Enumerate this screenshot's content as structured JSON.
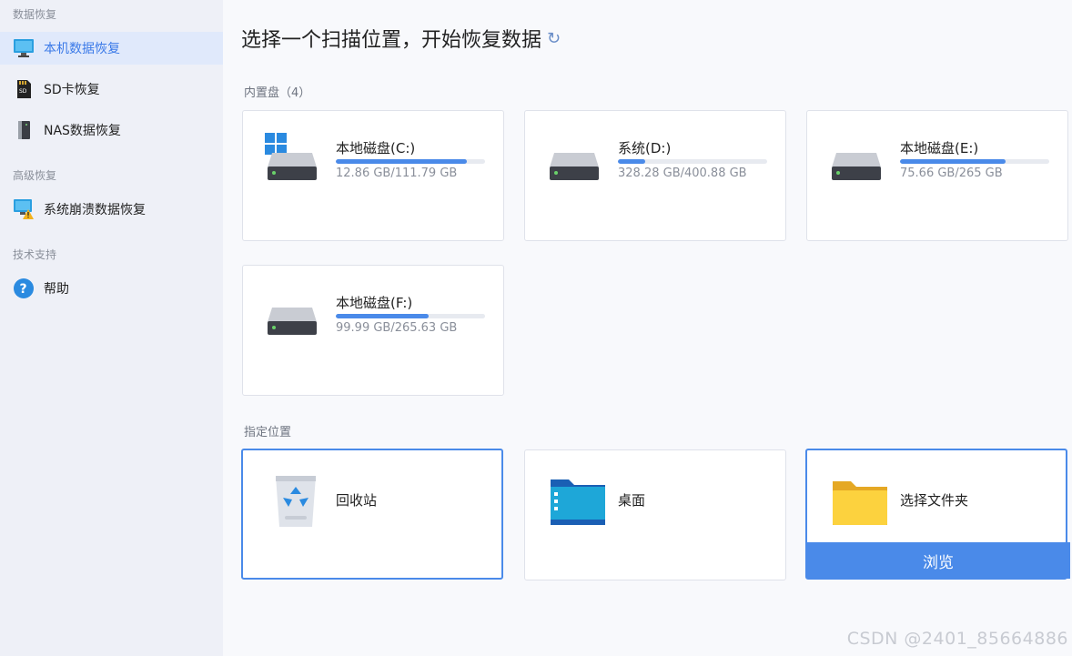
{
  "sidebar": {
    "sections": [
      {
        "title": "数据恢复"
      },
      {
        "title": "高级恢复"
      },
      {
        "title": "技术支持"
      }
    ],
    "items": [
      {
        "label": "本机数据恢复",
        "icon": "monitor-icon",
        "active": true
      },
      {
        "label": "SD卡恢复",
        "icon": "sd-card-icon"
      },
      {
        "label": "NAS数据恢复",
        "icon": "nas-icon"
      },
      {
        "label": "系统崩溃数据恢复",
        "icon": "crash-monitor-warning-icon"
      },
      {
        "label": "帮助",
        "icon": "help-question-icon"
      }
    ]
  },
  "main": {
    "title": "选择一个扫描位置，开始恢复数据",
    "refresh_icon": "↻",
    "drives_label": "内置盘（4）",
    "drives": [
      {
        "name": "本地磁盘(C:)",
        "usage": "12.86 GB/111.79 GB",
        "fill": 0.877,
        "system": true
      },
      {
        "name": "系统(D:)",
        "usage": "328.28 GB/400.88 GB",
        "fill": 0.18
      },
      {
        "name": "本地磁盘(E:)",
        "usage": "75.66 GB/265 GB",
        "fill": 0.71
      },
      {
        "name": "本地磁盘(F:)",
        "usage": "99.99 GB/265.63 GB",
        "fill": 0.62
      }
    ],
    "locations_label": "指定位置",
    "locations": [
      {
        "name": "回收站",
        "icon": "recycle-bin-icon"
      },
      {
        "name": "桌面",
        "icon": "desktop-folder-icon"
      },
      {
        "name": "选择文件夹",
        "icon": "folder-icon"
      }
    ],
    "browse_label": "浏览"
  },
  "colors": {
    "accent": "#4a8ae9",
    "sidebar_bg": "#eef0f7",
    "active_bg": "#e0e9fb"
  },
  "watermark": "CSDN @2401_85664886"
}
